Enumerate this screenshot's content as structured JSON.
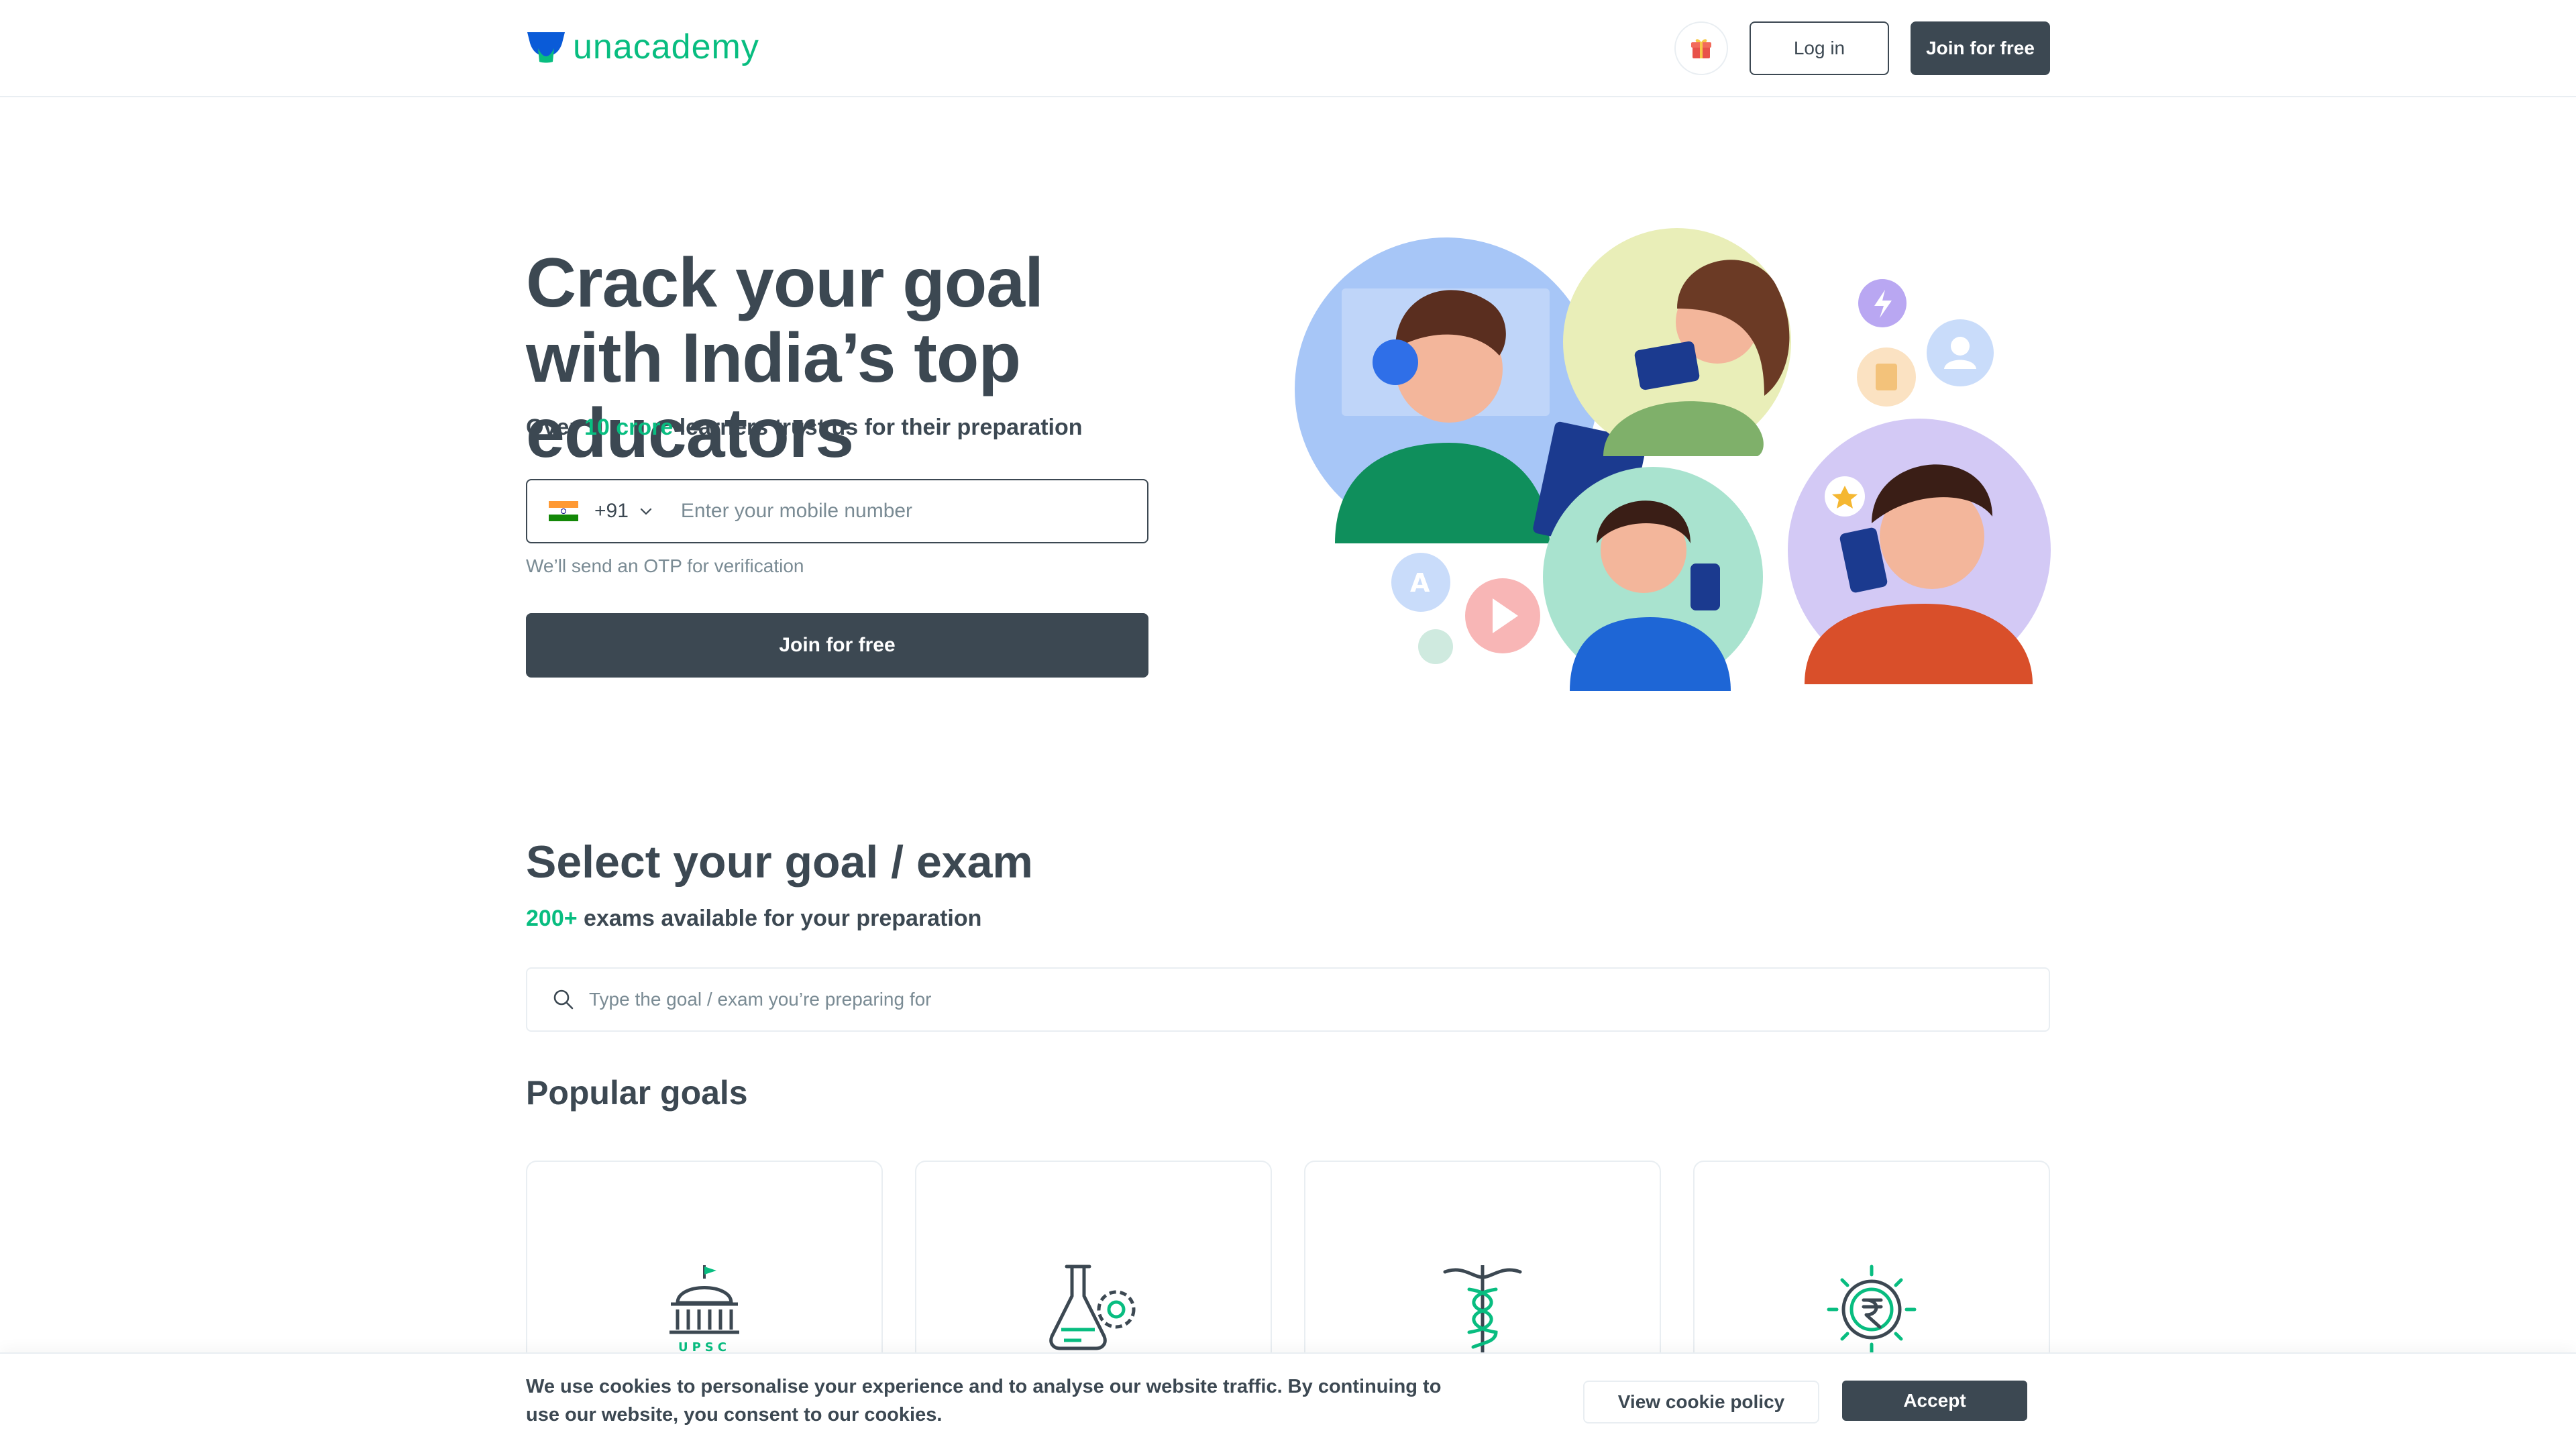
{
  "header": {
    "logo_text": "unacademy",
    "login_label": "Log in",
    "join_label": "Join for free",
    "icons": [
      "logo-icon",
      "gift-icon"
    ]
  },
  "hero": {
    "title": "Crack your goal with India’s top educators",
    "subtitle_prefix": "Over ",
    "subtitle_accent": "10 crore",
    "subtitle_suffix": " learners trust us for their preparation",
    "country_code": "+91",
    "phone_placeholder": "Enter your mobile number",
    "otp_note": "We’ll send an OTP for verification",
    "join_label": "Join for free"
  },
  "goals": {
    "title": "Select your goal / exam",
    "subtitle_accent": "200+",
    "subtitle_suffix": " exams available for your preparation",
    "search_placeholder": "Type the goal / exam you’re preparing for",
    "popular_title": "Popular goals",
    "cards": [
      {
        "icon": "upsc-icon",
        "label": "UPSC"
      },
      {
        "icon": "lab-flask-icon"
      },
      {
        "icon": "medical-caduceus-icon"
      },
      {
        "icon": "rupee-coin-icon"
      }
    ]
  },
  "cookie": {
    "text": "We use cookies to personalise your experience and to analyse our website traffic. By continuing to use our website, you consent to our cookies.",
    "policy_label": "View cookie policy",
    "accept_label": "Accept"
  },
  "colors": {
    "brand_green": "#08bd80",
    "text_dark": "#3c4852",
    "muted": "#7a8b94",
    "border": "#e9eef2"
  }
}
